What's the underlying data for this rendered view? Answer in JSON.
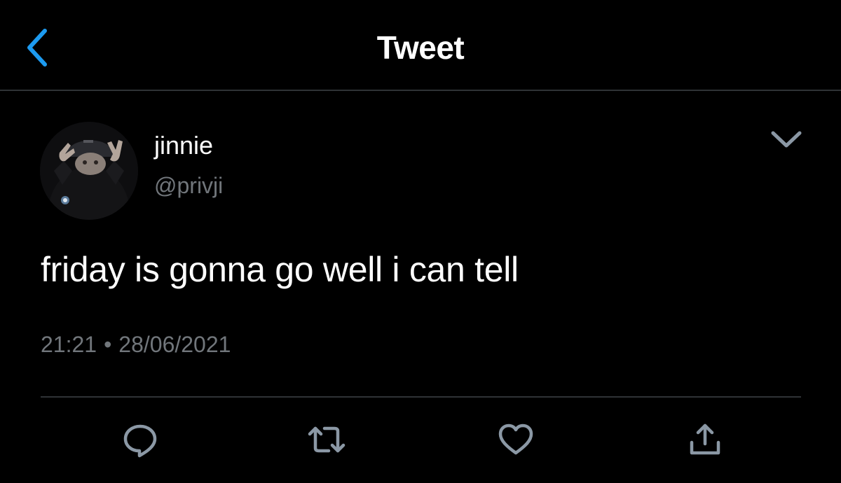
{
  "colors": {
    "background": "#000000",
    "accent": "#1d9bf0",
    "text_primary": "#ffffff",
    "text_secondary": "#71767b",
    "icon": "#8b98a5",
    "divider": "#2f3336"
  },
  "header": {
    "title": "Tweet",
    "back_icon": "chevron-left-icon"
  },
  "tweet": {
    "author": {
      "display_name": "jinnie",
      "handle": "@privji"
    },
    "more_icon": "chevron-down-icon",
    "text": "friday is gonna go well i can tell",
    "time": "21:21",
    "separator": "•",
    "date": "28/06/2021"
  },
  "actions": [
    {
      "icon": "reply-icon"
    },
    {
      "icon": "retweet-icon"
    },
    {
      "icon": "like-icon"
    },
    {
      "icon": "share-icon"
    }
  ]
}
